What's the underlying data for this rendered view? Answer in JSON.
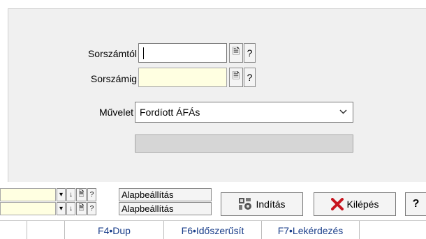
{
  "form": {
    "from_label": "Sorszámtól",
    "from_value": "",
    "to_label": "Sorszámig",
    "to_value": "",
    "operation_label": "Művelet",
    "operation_value": "Fordíott ÁFÁs",
    "lookup_glyph": "🗎",
    "help_glyph": "?"
  },
  "filters": {
    "rows": [
      {
        "value": "",
        "label": "Alapbeállítás"
      },
      {
        "value": "",
        "label": "Alapbeállítás"
      }
    ],
    "dropdown_glyph": "▾",
    "down_glyph": "↓",
    "doc_glyph": "🗎",
    "help_glyph": "?"
  },
  "buttons": {
    "start_label": "Indítás",
    "exit_label": "Kilépés",
    "help_label": "?"
  },
  "statusbar": {
    "f4": "F4•Dup",
    "f6": "F6•Időszerűsít",
    "f7": "F7•Lekérdezés"
  },
  "colors": {
    "required_field": "#ffffe1",
    "exit_icon": "#c8141e",
    "status_text": "#1a3e8a"
  },
  "icons": {
    "start": "gear-puzzle-icon",
    "exit": "red-x-icon",
    "chevron": "chevron-down-icon"
  }
}
